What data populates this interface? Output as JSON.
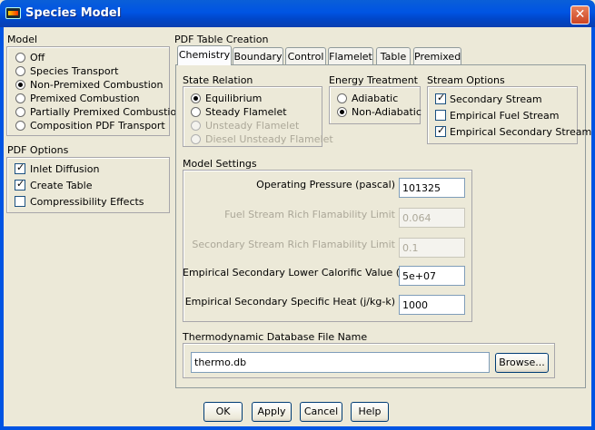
{
  "window": {
    "title": "Species Model",
    "close_glyph": "✕"
  },
  "model": {
    "label": "Model",
    "options": [
      {
        "label": "Off",
        "selected": false
      },
      {
        "label": "Species Transport",
        "selected": false
      },
      {
        "label": "Non-Premixed Combustion",
        "selected": true
      },
      {
        "label": "Premixed Combustion",
        "selected": false
      },
      {
        "label": "Partially Premixed Combustion",
        "selected": false
      },
      {
        "label": "Composition PDF Transport",
        "selected": false
      }
    ]
  },
  "pdf_options": {
    "label": "PDF Options",
    "options": [
      {
        "label": "Inlet Diffusion",
        "checked": true
      },
      {
        "label": "Create Table",
        "checked": true
      },
      {
        "label": "Compressibility Effects",
        "checked": false
      }
    ]
  },
  "pdf_table": {
    "label": "PDF Table Creation",
    "tabs": [
      "Chemistry",
      "Boundary",
      "Control",
      "Flamelet",
      "Table",
      "Premixed"
    ],
    "active_tab": "Chemistry"
  },
  "state_relation": {
    "label": "State Relation",
    "options": [
      {
        "label": "Equilibrium",
        "selected": true,
        "enabled": true
      },
      {
        "label": "Steady Flamelet",
        "selected": false,
        "enabled": true
      },
      {
        "label": "Unsteady Flamelet",
        "selected": false,
        "enabled": false
      },
      {
        "label": "Diesel Unsteady Flamelet",
        "selected": false,
        "enabled": false
      }
    ]
  },
  "energy_treatment": {
    "label": "Energy Treatment",
    "options": [
      {
        "label": "Adiabatic",
        "selected": false
      },
      {
        "label": "Non-Adiabatic",
        "selected": true
      }
    ]
  },
  "stream_options": {
    "label": "Stream Options",
    "options": [
      {
        "label": "Secondary Stream",
        "checked": true
      },
      {
        "label": "Empirical Fuel Stream",
        "checked": false
      },
      {
        "label": "Empirical Secondary Stream",
        "checked": true
      }
    ]
  },
  "model_settings": {
    "label": "Model Settings",
    "fields": [
      {
        "label": "Operating Pressure (pascal)",
        "value": "101325",
        "enabled": true
      },
      {
        "label": "Fuel Stream Rich Flamability Limit",
        "value": "0.064",
        "enabled": false
      },
      {
        "label": "Secondary Stream Rich Flamability Limit",
        "value": "0.1",
        "enabled": false
      },
      {
        "label": "Empirical Secondary Lower Calorific Value (j/kg)",
        "value": "5e+07",
        "enabled": true
      },
      {
        "label": "Empirical Secondary Specific Heat (j/kg-k)",
        "value": "1000",
        "enabled": true
      }
    ]
  },
  "thermo_db": {
    "label": "Thermodynamic Database File Name",
    "value": "thermo.db",
    "browse_label": "Browse..."
  },
  "footer": {
    "ok": "OK",
    "apply": "Apply",
    "cancel": "Cancel",
    "help": "Help"
  }
}
